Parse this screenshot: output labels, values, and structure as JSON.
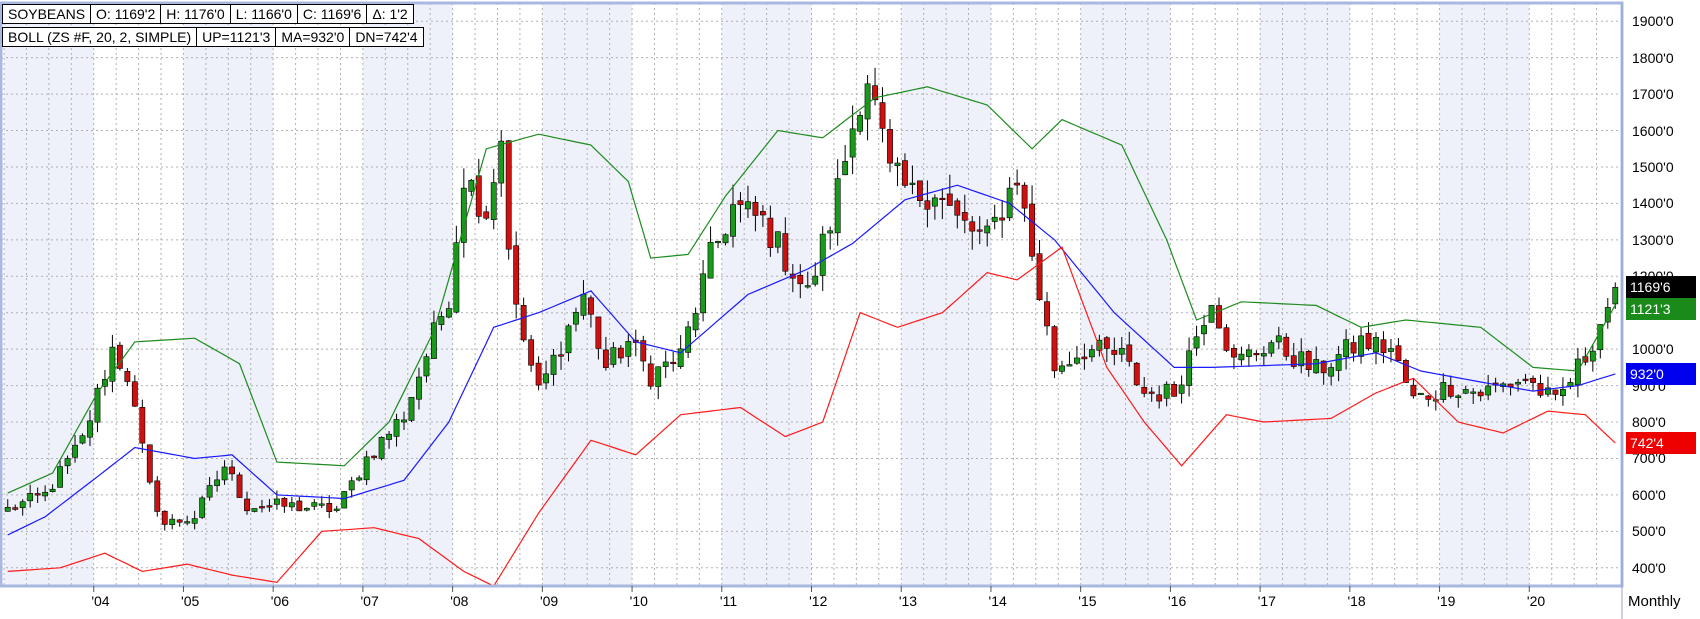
{
  "info": {
    "row1": [
      "SOYBEANS",
      "O: 1169'2",
      "H: 1176'0",
      "L: 1166'0",
      "C: 1169'6",
      "Δ: 1'2"
    ],
    "row2": [
      "BOLL (ZS #F, 20, 2, SIMPLE)",
      "UP=1121'3",
      "MA=932'0",
      "DN=742'4"
    ]
  },
  "period": "Monthly",
  "price_tags": [
    {
      "label": "1169'6",
      "value": 1169.75,
      "color": "#000000"
    },
    {
      "label": "1121'3",
      "value": 1121.375,
      "color": "#1a8a1a"
    },
    {
      "label": "932'0",
      "value": 932,
      "color": "#0000ee"
    },
    {
      "label": "742'4",
      "value": 742.5,
      "color": "#ee0000"
    }
  ],
  "colors": {
    "up_candle": "#1a9a1a",
    "down_candle": "#cc1111",
    "upper_band": "#1e8c1e",
    "middle_band": "#1a1aff",
    "lower_band": "#ff1a1a",
    "frame": "#a9b8e0",
    "shade": "#eef0fa",
    "grid": "#b0b0b0"
  },
  "chart_data": {
    "type": "candlestick",
    "title": "SOYBEANS",
    "ylim": [
      350,
      1950
    ],
    "y_ticks": [
      {
        "value": 400,
        "label": "400'0"
      },
      {
        "value": 500,
        "label": "500'0"
      },
      {
        "value": 600,
        "label": "600'0"
      },
      {
        "value": 700,
        "label": "700'0"
      },
      {
        "value": 800,
        "label": "800'0"
      },
      {
        "value": 900,
        "label": "900'0"
      },
      {
        "value": 1000,
        "label": "1000'0"
      },
      {
        "value": 1100,
        "label": "1100'0"
      },
      {
        "value": 1200,
        "label": "1200'0"
      },
      {
        "value": 1300,
        "label": "1300'0"
      },
      {
        "value": 1400,
        "label": "1400'0"
      },
      {
        "value": 1500,
        "label": "1500'0"
      },
      {
        "value": 1600,
        "label": "1600'0"
      },
      {
        "value": 1700,
        "label": "1700'0"
      },
      {
        "value": 1800,
        "label": "1800'0"
      },
      {
        "value": 1900,
        "label": "1900'0"
      }
    ],
    "x_ticks": [
      "'04",
      "'05",
      "'06",
      "'07",
      "'08",
      "'09",
      "'10",
      "'11",
      "'12",
      "'13",
      "'14",
      "'15",
      "'16",
      "'17",
      "'18",
      "'19",
      "'20"
    ],
    "x_start": "2003-01",
    "x_end": "2020-12",
    "close_anchors": [
      [
        "2003-01",
        560
      ],
      [
        "2003-06",
        600
      ],
      [
        "2003-11",
        750
      ],
      [
        "2004-03",
        1000
      ],
      [
        "2004-05",
        930
      ],
      [
        "2004-08",
        620
      ],
      [
        "2004-10",
        520
      ],
      [
        "2005-02",
        540
      ],
      [
        "2005-06",
        680
      ],
      [
        "2005-09",
        570
      ],
      [
        "2006-02",
        570
      ],
      [
        "2006-09",
        560
      ],
      [
        "2007-01",
        700
      ],
      [
        "2007-06",
        820
      ],
      [
        "2007-12",
        1150
      ],
      [
        "2008-02",
        1480
      ],
      [
        "2008-05",
        1380
      ],
      [
        "2008-07",
        1580
      ],
      [
        "2008-08",
        1300
      ],
      [
        "2008-09",
        1100
      ],
      [
        "2008-12",
        880
      ],
      [
        "2009-06",
        1150
      ],
      [
        "2009-09",
        950
      ],
      [
        "2009-12",
        1020
      ],
      [
        "2010-03",
        930
      ],
      [
        "2010-07",
        980
      ],
      [
        "2010-11",
        1250
      ],
      [
        "2011-02",
        1390
      ],
      [
        "2011-06",
        1350
      ],
      [
        "2011-09",
        1250
      ],
      [
        "2011-12",
        1150
      ],
      [
        "2012-03",
        1350
      ],
      [
        "2012-07",
        1700
      ],
      [
        "2012-08",
        1750
      ],
      [
        "2012-11",
        1480
      ],
      [
        "2013-02",
        1420
      ],
      [
        "2013-05",
        1440
      ],
      [
        "2013-08",
        1350
      ],
      [
        "2013-12",
        1300
      ],
      [
        "2014-04",
        1480
      ],
      [
        "2014-07",
        1150
      ],
      [
        "2014-09",
        950
      ],
      [
        "2015-01",
        1000
      ],
      [
        "2015-06",
        980
      ],
      [
        "2015-09",
        880
      ],
      [
        "2016-01",
        880
      ],
      [
        "2016-06",
        1150
      ],
      [
        "2016-09",
        960
      ],
      [
        "2017-02",
        1020
      ],
      [
        "2017-08",
        940
      ],
      [
        "2018-02",
        1020
      ],
      [
        "2018-06",
        1000
      ],
      [
        "2018-09",
        860
      ],
      [
        "2019-02",
        900
      ],
      [
        "2019-06",
        880
      ],
      [
        "2019-12",
        920
      ],
      [
        "2020-04",
        850
      ],
      [
        "2020-08",
        980
      ],
      [
        "2020-12",
        1170
      ]
    ],
    "upper_band": [
      [
        "2003-01",
        605
      ],
      [
        "2003-07",
        660
      ],
      [
        "2004-01",
        880
      ],
      [
        "2004-06",
        1020
      ],
      [
        "2005-02",
        1030
      ],
      [
        "2005-08",
        960
      ],
      [
        "2006-01",
        690
      ],
      [
        "2006-10",
        680
      ],
      [
        "2007-04",
        800
      ],
      [
        "2007-10",
        1050
      ],
      [
        "2008-05",
        1550
      ],
      [
        "2008-12",
        1590
      ],
      [
        "2009-07",
        1560
      ],
      [
        "2009-12",
        1460
      ],
      [
        "2010-03",
        1250
      ],
      [
        "2010-08",
        1260
      ],
      [
        "2011-01",
        1420
      ],
      [
        "2011-08",
        1600
      ],
      [
        "2012-02",
        1580
      ],
      [
        "2012-09",
        1690
      ],
      [
        "2013-04",
        1720
      ],
      [
        "2013-12",
        1670
      ],
      [
        "2014-06",
        1550
      ],
      [
        "2014-10",
        1630
      ],
      [
        "2015-06",
        1560
      ],
      [
        "2015-12",
        1300
      ],
      [
        "2016-04",
        1080
      ],
      [
        "2016-10",
        1130
      ],
      [
        "2017-08",
        1120
      ],
      [
        "2018-02",
        1060
      ],
      [
        "2018-08",
        1080
      ],
      [
        "2019-06",
        1060
      ],
      [
        "2020-01",
        950
      ],
      [
        "2020-07",
        940
      ],
      [
        "2020-12",
        1121.375
      ]
    ],
    "middle_band": [
      [
        "2003-01",
        490
      ],
      [
        "2003-06",
        540
      ],
      [
        "2004-01",
        650
      ],
      [
        "2004-06",
        730
      ],
      [
        "2005-02",
        700
      ],
      [
        "2005-07",
        710
      ],
      [
        "2006-01",
        600
      ],
      [
        "2006-10",
        590
      ],
      [
        "2007-06",
        640
      ],
      [
        "2007-12",
        800
      ],
      [
        "2008-06",
        1060
      ],
      [
        "2008-12",
        1100
      ],
      [
        "2009-07",
        1160
      ],
      [
        "2010-01",
        1020
      ],
      [
        "2010-07",
        990
      ],
      [
        "2011-04",
        1150
      ],
      [
        "2011-12",
        1220
      ],
      [
        "2012-06",
        1290
      ],
      [
        "2013-01",
        1410
      ],
      [
        "2013-08",
        1450
      ],
      [
        "2014-03",
        1400
      ],
      [
        "2014-09",
        1300
      ],
      [
        "2015-05",
        1100
      ],
      [
        "2016-01",
        950
      ],
      [
        "2016-06",
        950
      ],
      [
        "2017-08",
        960
      ],
      [
        "2018-04",
        990
      ],
      [
        "2018-10",
        940
      ],
      [
        "2019-06",
        910
      ],
      [
        "2020-01",
        885
      ],
      [
        "2020-07",
        900
      ],
      [
        "2020-12",
        932
      ]
    ],
    "lower_band": [
      [
        "2003-01",
        390
      ],
      [
        "2003-08",
        400
      ],
      [
        "2004-02",
        440
      ],
      [
        "2004-07",
        390
      ],
      [
        "2005-01",
        410
      ],
      [
        "2005-07",
        380
      ],
      [
        "2006-01",
        360
      ],
      [
        "2006-07",
        500
      ],
      [
        "2007-02",
        510
      ],
      [
        "2007-08",
        480
      ],
      [
        "2008-02",
        390
      ],
      [
        "2008-06",
        350
      ],
      [
        "2008-12",
        550
      ],
      [
        "2009-07",
        750
      ],
      [
        "2010-01",
        710
      ],
      [
        "2010-07",
        820
      ],
      [
        "2011-03",
        840
      ],
      [
        "2011-09",
        760
      ],
      [
        "2012-02",
        800
      ],
      [
        "2012-07",
        1100
      ],
      [
        "2012-12",
        1060
      ],
      [
        "2013-06",
        1100
      ],
      [
        "2013-12",
        1210
      ],
      [
        "2014-04",
        1190
      ],
      [
        "2014-10",
        1280
      ],
      [
        "2015-04",
        950
      ],
      [
        "2015-09",
        800
      ],
      [
        "2016-02",
        680
      ],
      [
        "2016-08",
        820
      ],
      [
        "2017-01",
        800
      ],
      [
        "2017-10",
        810
      ],
      [
        "2018-04",
        880
      ],
      [
        "2018-09",
        920
      ],
      [
        "2019-03",
        800
      ],
      [
        "2019-09",
        770
      ],
      [
        "2020-03",
        830
      ],
      [
        "2020-08",
        820
      ],
      [
        "2020-12",
        742.5
      ]
    ]
  }
}
